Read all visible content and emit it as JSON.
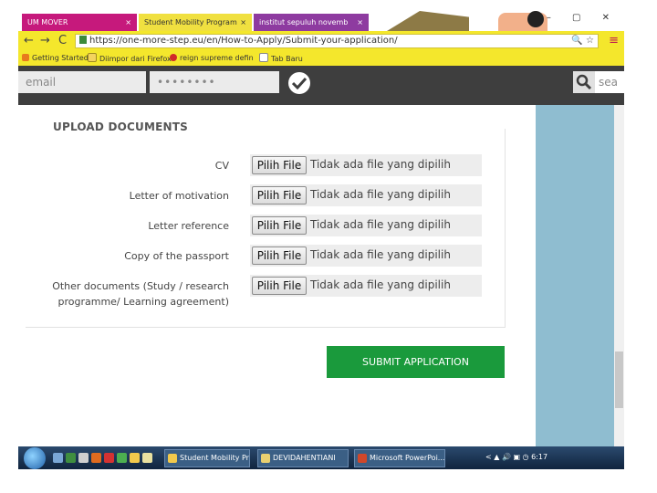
{
  "browser": {
    "tabs": [
      {
        "label": "UM MOVER",
        "close": "×"
      },
      {
        "label": "Student Mobility Program",
        "close": "×"
      },
      {
        "label": "institut sepuluh novemb",
        "close": "×"
      }
    ],
    "window_controls": "– ▢ ✕",
    "nav": {
      "back": "←",
      "forward": "→",
      "reload": "C"
    },
    "url": "https://one-more-step.eu/en/How-to-Apply/Submit-your-application/",
    "url_icons": "🔍 ☆",
    "menu": "≡",
    "bookmarks": [
      {
        "label": "Getting Started"
      },
      {
        "label": "Diimpor dari Firefox"
      },
      {
        "label": "reign supreme defin"
      },
      {
        "label": "Tab Baru"
      }
    ]
  },
  "header": {
    "email_placeholder": "email",
    "password_value": "••••••••",
    "search_placeholder": "sea"
  },
  "upload": {
    "title": "UPLOAD DOCUMENTS",
    "choose_label": "Pilih File",
    "no_file_text": "Tidak ada file yang dipilih",
    "rows": [
      {
        "label": "CV"
      },
      {
        "label": "Letter of motivation"
      },
      {
        "label": "Letter reference"
      },
      {
        "label": "Copy of the passport"
      },
      {
        "label_line1": "Other documents (Study / research",
        "label_line2": "programme/ Learning agreement)"
      }
    ],
    "submit_label": "SUBMIT APPLICATION"
  },
  "taskbar": {
    "windows": [
      {
        "label": "Student Mobility Pr..."
      },
      {
        "label": "DEVIDAHENTIANI"
      },
      {
        "label": "Microsoft PowerPoi..."
      }
    ],
    "tray_text": "< ▲ 🔊 ▣ ◷ 6:17"
  },
  "colors": {
    "address_bar": "#f4e72c",
    "header_bg": "#3e3e3e",
    "submit_green": "#1a9a3c",
    "right_panel": "#8fbdd0",
    "tab_magenta": "#c6197c"
  }
}
